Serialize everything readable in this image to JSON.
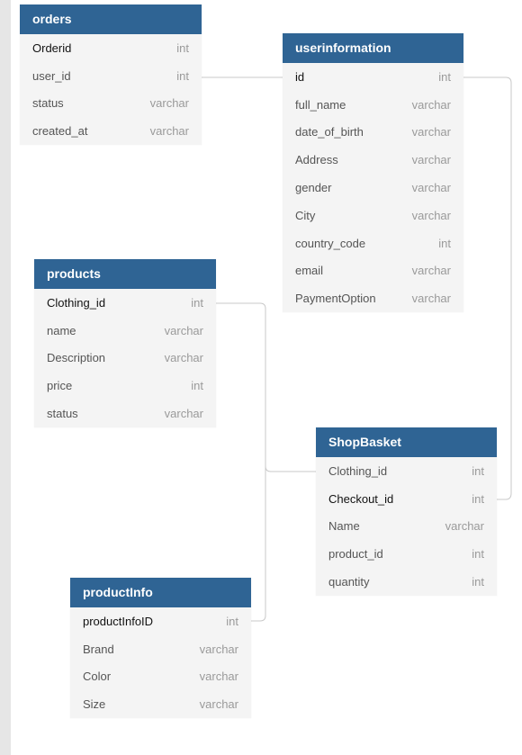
{
  "tables": {
    "orders": {
      "title": "orders",
      "columns": [
        {
          "name": "Orderid",
          "type": "int",
          "key": true
        },
        {
          "name": "user_id",
          "type": "int",
          "key": false
        },
        {
          "name": "status",
          "type": "varchar",
          "key": false
        },
        {
          "name": "created_at",
          "type": "varchar",
          "key": false
        }
      ]
    },
    "userinformation": {
      "title": "userinformation",
      "columns": [
        {
          "name": "id",
          "type": "int",
          "key": true
        },
        {
          "name": "full_name",
          "type": "varchar",
          "key": false
        },
        {
          "name": "date_of_birth",
          "type": "varchar",
          "key": false
        },
        {
          "name": "Address",
          "type": "varchar",
          "key": false
        },
        {
          "name": "gender",
          "type": "varchar",
          "key": false
        },
        {
          "name": "City",
          "type": "varchar",
          "key": false
        },
        {
          "name": "country_code",
          "type": "int",
          "key": false
        },
        {
          "name": "email",
          "type": "varchar",
          "key": false
        },
        {
          "name": "PaymentOption",
          "type": "varchar",
          "key": false
        }
      ]
    },
    "products": {
      "title": "products",
      "columns": [
        {
          "name": "Clothing_id",
          "type": "int",
          "key": true
        },
        {
          "name": "name",
          "type": "varchar",
          "key": false
        },
        {
          "name": "Description",
          "type": "varchar",
          "key": false
        },
        {
          "name": "price",
          "type": "int",
          "key": false
        },
        {
          "name": "status",
          "type": "varchar",
          "key": false
        }
      ]
    },
    "shopbasket": {
      "title": "ShopBasket",
      "columns": [
        {
          "name": "Clothing_id",
          "type": "int",
          "key": false
        },
        {
          "name": "Checkout_id",
          "type": "int",
          "key": true
        },
        {
          "name": "Name",
          "type": "varchar",
          "key": false
        },
        {
          "name": "product_id",
          "type": "int",
          "key": false
        },
        {
          "name": "quantity",
          "type": "int",
          "key": false
        }
      ]
    },
    "productinfo": {
      "title": "productInfo",
      "columns": [
        {
          "name": "productInfoID",
          "type": "int",
          "key": true
        },
        {
          "name": "Brand",
          "type": "varchar",
          "key": false
        },
        {
          "name": "Color",
          "type": "varchar",
          "key": false
        },
        {
          "name": "Size",
          "type": "varchar",
          "key": false
        }
      ]
    }
  },
  "colors": {
    "header": "#2f6494",
    "body": "#f4f4f4",
    "connector": "#c8c8c8"
  }
}
